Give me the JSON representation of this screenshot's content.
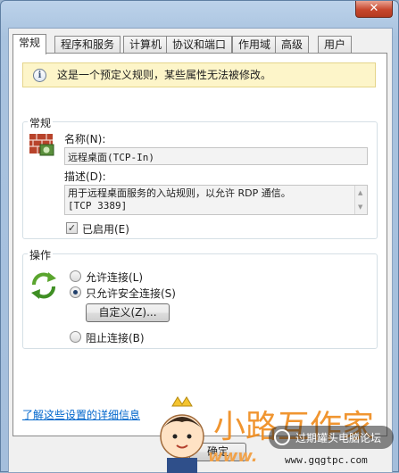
{
  "window": {
    "close_glyph": "✕"
  },
  "tabs": [
    {
      "label": "常规",
      "active": true
    },
    {
      "label": "程序和服务"
    },
    {
      "label": "计算机"
    },
    {
      "label": "协议和端口"
    },
    {
      "label": "作用域"
    },
    {
      "label": "高级"
    },
    {
      "label": "用户"
    }
  ],
  "info": {
    "icon": "info-icon",
    "text": "这是一个预定义规则，某些属性无法被修改。"
  },
  "general": {
    "group_title": "常规",
    "icon": "firewall-brick-icon",
    "name_label": "名称(N):",
    "name_value": "远程桌面(TCP-In)",
    "desc_label": "描述(D):",
    "desc_value_line1": "用于远程桌面服务的入站规则，以允许 RDP 通信。",
    "desc_value_line2": "[TCP 3389]",
    "enabled_label": "已启用(E)",
    "enabled_checked": true
  },
  "action": {
    "group_title": "操作",
    "icon": "refresh-arrows-icon",
    "allow_label": "允许连接(L)",
    "allow_secure_label": "只允许安全连接(S)",
    "customize_button": "自定义(Z)...",
    "block_label": "阻止连接(B)",
    "selected": "allow_secure"
  },
  "learn_more_link": "了解这些设置的详细信息",
  "buttons": {
    "ok": "确定"
  },
  "watermark": {
    "brand": "小路互作家",
    "url": "www.",
    "forum": "过期罐头电脑论坛",
    "forum_url": "www.gqgtpc.com"
  },
  "colors": {
    "accent_link": "#0066cc",
    "info_bg": "#fdf5c9",
    "brand_orange": "#ef8a1a"
  }
}
